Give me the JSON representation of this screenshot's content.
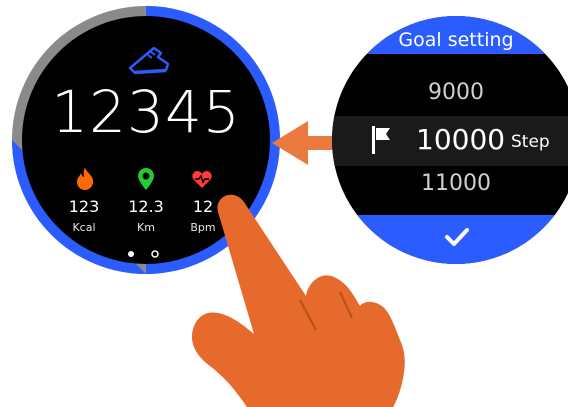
{
  "watch_main": {
    "steps": "12345",
    "stats": [
      {
        "value": "123",
        "unit": "Kcal",
        "icon": "flame-icon",
        "color": "#ff6a00"
      },
      {
        "value": "12.3",
        "unit": "Km",
        "icon": "location-pin-icon",
        "color": "#22cc33"
      },
      {
        "value": "12",
        "unit": "Bpm",
        "icon": "heartbeat-icon",
        "color": "#ff3b3b"
      }
    ],
    "page_index": 1,
    "page_count": 2
  },
  "watch_goal": {
    "title": "Goal setting",
    "options": {
      "prev": "9000",
      "selected": "10000",
      "unit": "Step",
      "next": "11000"
    },
    "confirm_icon": "checkmark-icon"
  },
  "colors": {
    "accent_blue": "#2b5cff",
    "arrow_orange": "#ea7a3d",
    "hand_orange": "#e56a2b"
  }
}
